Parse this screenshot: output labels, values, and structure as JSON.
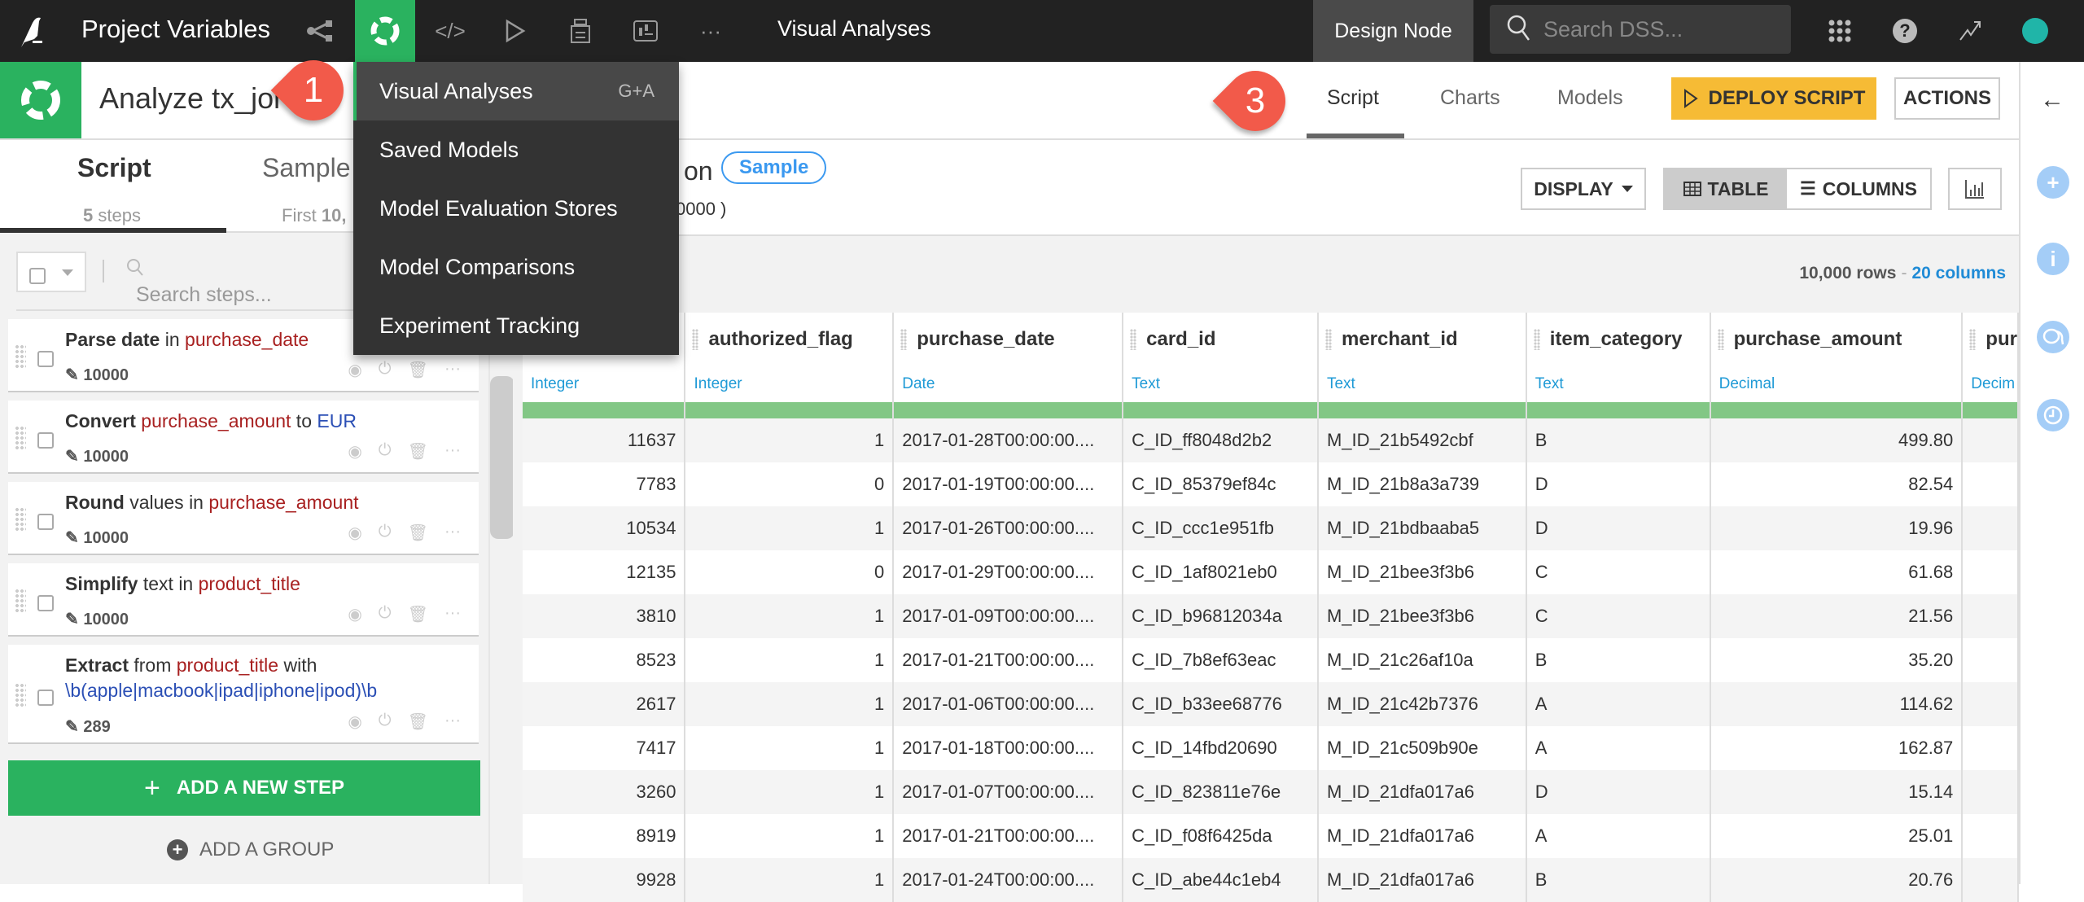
{
  "nav": {
    "project_name": "Project Variables",
    "context_title": "Visual Analyses",
    "instance_label": "Design Node",
    "search_placeholder": "Search DSS...",
    "icons": [
      "flow-icon",
      "analysis-icon",
      "code-icon",
      "run-icon",
      "datasets-stack-icon",
      "dashboard-icon",
      "more-icon"
    ]
  },
  "header": {
    "title": "Analyze tx_joi",
    "tabs": [
      {
        "label": "Script",
        "active": true
      },
      {
        "label": "Charts",
        "active": false
      },
      {
        "label": "Models",
        "active": false
      }
    ],
    "deploy_label": "DEPLOY SCRIPT",
    "actions_label": "ACTIONS"
  },
  "menu": {
    "items": [
      {
        "label": "Visual Analyses",
        "shortcut": "G+A",
        "highlighted": true
      },
      {
        "label": "Saved Models",
        "shortcut": ""
      },
      {
        "label": "Model Evaluation Stores",
        "shortcut": ""
      },
      {
        "label": "Model Comparisons",
        "shortcut": ""
      },
      {
        "label": "Experiment Tracking",
        "shortcut": ""
      }
    ]
  },
  "callouts": {
    "one": "1",
    "three": "3"
  },
  "left_panel": {
    "tab_script": "Script",
    "tab_script_sub_count": "5",
    "tab_script_sub_label": "steps",
    "tab_sample": "Sample",
    "tab_sample_sub_prefix": "First",
    "tab_sample_sub_value": "10,",
    "search_placeholder": "Search steps...",
    "steps": [
      {
        "verb": "Parse date",
        "mid": " in ",
        "column": "purchase_date",
        "tail": "",
        "value": "",
        "count": "10000"
      },
      {
        "verb": "Convert",
        "mid": " ",
        "column": "purchase_amount",
        "tail": " to ",
        "value": "EUR",
        "count": "10000"
      },
      {
        "verb": "Round",
        "mid": " values in ",
        "column": "purchase_amount",
        "tail": "",
        "value": "",
        "count": "10000"
      },
      {
        "verb": "Simplify",
        "mid": " text in ",
        "column": "product_title",
        "tail": "",
        "value": "",
        "count": "10000"
      },
      {
        "verb": "Extract",
        "mid": " from ",
        "column": "product_title",
        "tail": " with ",
        "value": "\\b(apple|macbook|ipad|iphone|ipod)\\b",
        "count": "289"
      }
    ],
    "add_step_label": "ADD A NEW STEP",
    "add_group_label": "ADD A GROUP"
  },
  "main": {
    "on_text": "on",
    "sample_badge": "Sample",
    "rows_paren": "0000 )",
    "display_label": "DISPLAY",
    "table_label": "TABLE",
    "columns_label": "COLUMNS",
    "row_count": "10,000 rows",
    "col_count": "20 columns",
    "columns": [
      {
        "name": "",
        "type": "Integer"
      },
      {
        "name": "authorized_flag",
        "type": "Integer"
      },
      {
        "name": "purchase_date",
        "type": "Date"
      },
      {
        "name": "card_id",
        "type": "Text"
      },
      {
        "name": "merchant_id",
        "type": "Text"
      },
      {
        "name": "item_category",
        "type": "Text"
      },
      {
        "name": "purchase_amount",
        "type": "Decimal"
      },
      {
        "name": "pur",
        "type": "Decim"
      }
    ],
    "rows": [
      [
        "11637",
        "1",
        "2017-01-28T00:00:00....",
        "C_ID_ff8048d2b2",
        "M_ID_21b5492cbf",
        "B",
        "499.80",
        ""
      ],
      [
        "7783",
        "0",
        "2017-01-19T00:00:00....",
        "C_ID_85379ef84c",
        "M_ID_21b8a3a739",
        "D",
        "82.54",
        ""
      ],
      [
        "10534",
        "1",
        "2017-01-26T00:00:00....",
        "C_ID_ccc1e951fb",
        "M_ID_21bdbaaba5",
        "D",
        "19.96",
        ""
      ],
      [
        "12135",
        "0",
        "2017-01-29T00:00:00....",
        "C_ID_1af8021eb0",
        "M_ID_21bee3f3b6",
        "C",
        "61.68",
        ""
      ],
      [
        "3810",
        "1",
        "2017-01-09T00:00:00....",
        "C_ID_b96812034a",
        "M_ID_21bee3f3b6",
        "C",
        "21.56",
        ""
      ],
      [
        "8523",
        "1",
        "2017-01-21T00:00:00....",
        "C_ID_7b8ef63eac",
        "M_ID_21c26af10a",
        "B",
        "35.20",
        ""
      ],
      [
        "2617",
        "1",
        "2017-01-06T00:00:00....",
        "C_ID_b33ee68776",
        "M_ID_21c42b7376",
        "A",
        "114.62",
        ""
      ],
      [
        "7417",
        "1",
        "2017-01-18T00:00:00....",
        "C_ID_14fbd20690",
        "M_ID_21c509b90e",
        "A",
        "162.87",
        ""
      ],
      [
        "3260",
        "1",
        "2017-01-07T00:00:00....",
        "C_ID_823811e76e",
        "M_ID_21dfa017a6",
        "D",
        "15.14",
        ""
      ],
      [
        "8919",
        "1",
        "2017-01-21T00:00:00....",
        "C_ID_f08f6425da",
        "M_ID_21dfa017a6",
        "A",
        "25.01",
        ""
      ],
      [
        "9928",
        "1",
        "2017-01-24T00:00:00....",
        "C_ID_abe44c1eb4",
        "M_ID_21dfa017a6",
        "B",
        "20.76",
        ""
      ]
    ]
  },
  "colors": {
    "brand_green": "#2ab25f",
    "deploy_yellow": "#f6bb35",
    "callout_red": "#f25a4a",
    "type_blue": "#1f9ad6",
    "column_red": "#a82020",
    "value_blue": "#2b4fb5"
  }
}
